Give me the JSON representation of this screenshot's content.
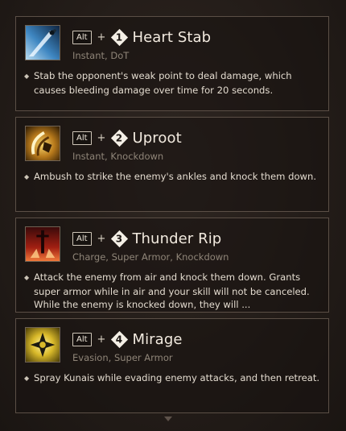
{
  "skills": [
    {
      "icon": "dagger-stab-icon",
      "modifier_key": "Alt",
      "plus": "+",
      "number": "1",
      "name": "Heart Stab",
      "tags": "Instant, DoT",
      "description": "Stab the opponent's weak point to deal damage, which causes bleeding damage over time for 20 seconds."
    },
    {
      "icon": "uproot-slash-icon",
      "modifier_key": "Alt",
      "plus": "+",
      "number": "2",
      "name": "Uproot",
      "tags": "Instant, Knockdown",
      "description": "Ambush to strike the enemy's ankles and knock them down."
    },
    {
      "icon": "thunder-rip-icon",
      "modifier_key": "Alt",
      "plus": "+",
      "number": "3",
      "name": "Thunder Rip",
      "tags": "Charge, Super Armor, Knockdown",
      "description": "Attack the enemy from air and knock them down. Grants super armor while in air and your skill will not be canceled. While the enemy is knocked down, they will ..."
    },
    {
      "icon": "shuriken-mirage-icon",
      "modifier_key": "Alt",
      "plus": "+",
      "number": "4",
      "name": "Mirage",
      "tags": "Evasion, Super Armor",
      "description": "Spray Kunais while evading enemy attacks, and then retreat."
    }
  ],
  "bullet_glyph": "◆",
  "scroll_icon": "chevron-down-icon"
}
